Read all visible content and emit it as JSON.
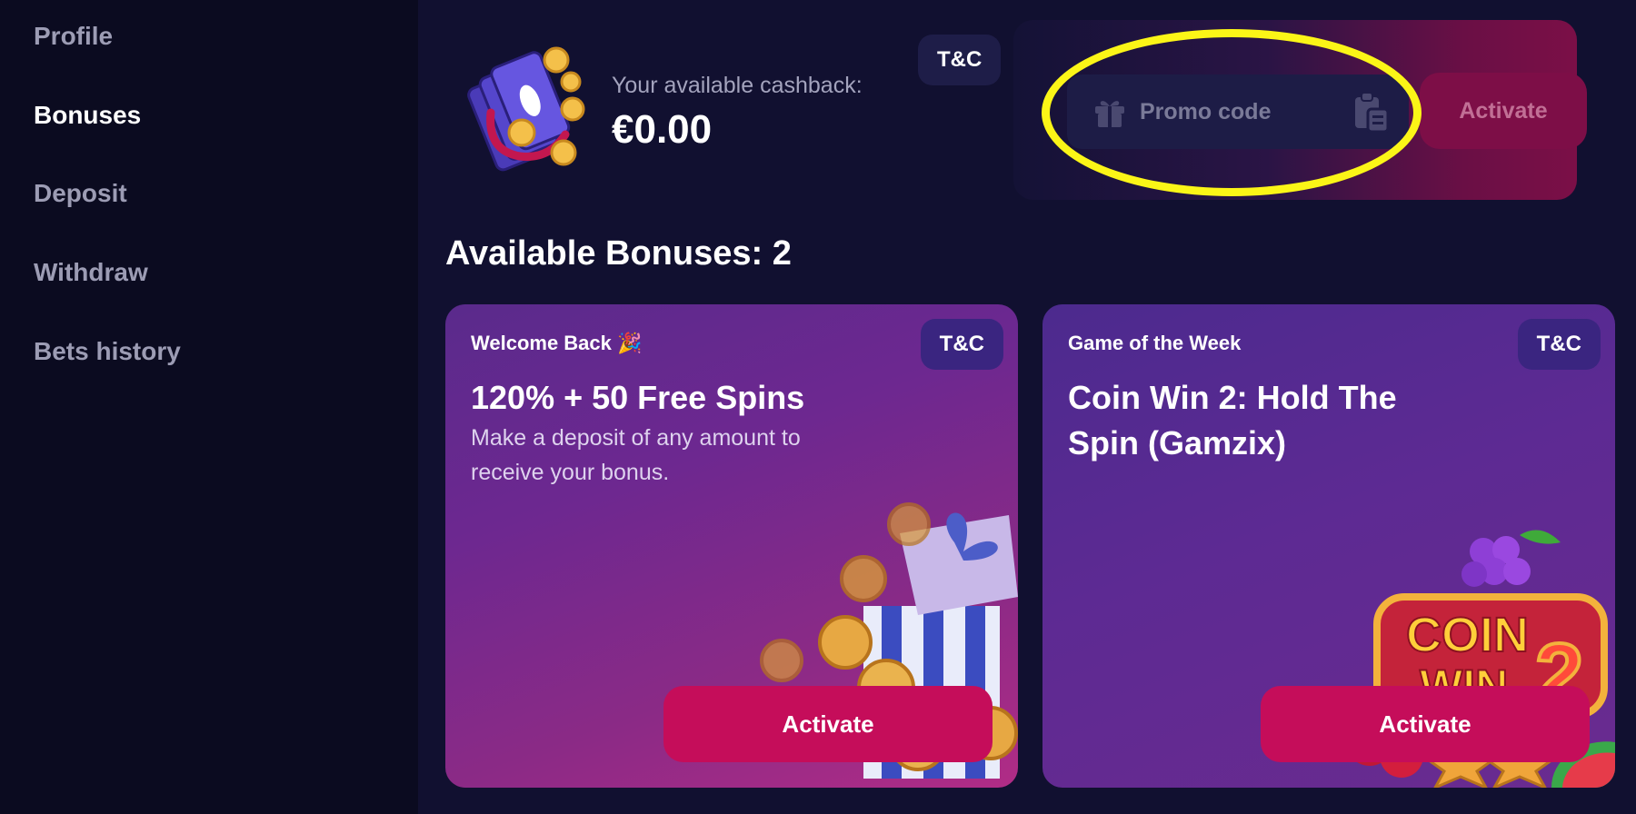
{
  "sidebar": {
    "items": [
      {
        "label": "Profile",
        "active": false
      },
      {
        "label": "Bonuses",
        "active": true
      },
      {
        "label": "Deposit",
        "active": false
      },
      {
        "label": "Withdraw",
        "active": false
      },
      {
        "label": "Bets history",
        "active": false
      }
    ]
  },
  "cashback": {
    "label": "Your available cashback:",
    "amount": "€0.00",
    "tc_label": "T&C",
    "icon": "cashback-cards-coins-icon"
  },
  "promo": {
    "placeholder": "Promo code",
    "activate_label": "Activate",
    "gift_icon": "gift-icon",
    "paste_icon": "clipboard-paste-icon",
    "highlight_color": "#fbf517"
  },
  "bonuses": {
    "title": "Available Bonuses: 2",
    "cards": [
      {
        "tag": "Welcome Back 🎉",
        "title": "120% + 50 Free Spins",
        "description": "Make a deposit of any amount to receive your bonus.",
        "tc_label": "T&C",
        "activate_label": "Activate",
        "art": "gift-box-coins-icon"
      },
      {
        "tag": "Game of the Week",
        "title": "Coin Win 2: Hold The Spin (Gamzix)",
        "description": "",
        "tc_label": "T&C",
        "activate_label": "Activate",
        "art": "coin-win-2-fruits-icon"
      }
    ]
  },
  "colors": {
    "background": "#0b0b20",
    "main_background": "#111030",
    "accent": "#c50d5a",
    "tc_chip": "#1e1d48"
  }
}
